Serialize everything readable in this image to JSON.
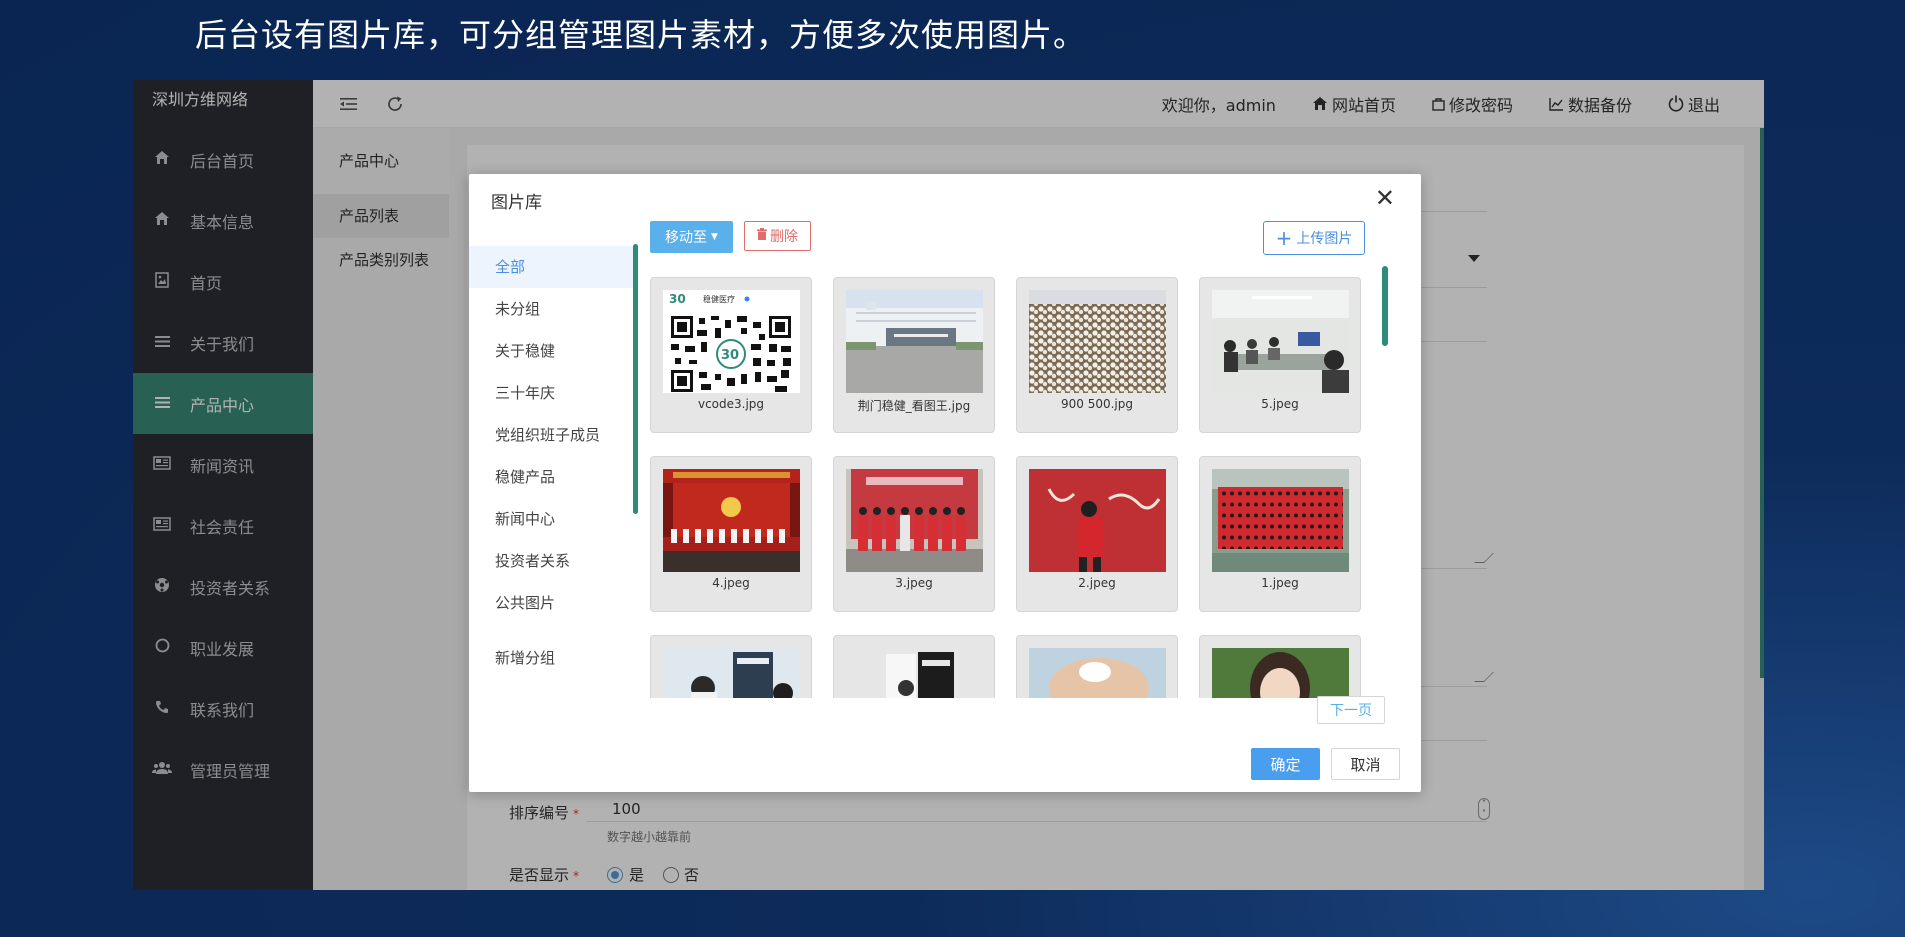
{
  "headline": "后台设有图片库，可分组管理图片素材，方便多次使用图片。",
  "sidebar": {
    "brand": "深圳方维网络",
    "items": [
      {
        "label": "后台首页",
        "icon": "home-icon"
      },
      {
        "label": "基本信息",
        "icon": "home-icon"
      },
      {
        "label": "首页",
        "icon": "image-file-icon"
      },
      {
        "label": "关于我们",
        "icon": "list-icon"
      },
      {
        "label": "产品中心",
        "icon": "list-icon",
        "active": true
      },
      {
        "label": "新闻资讯",
        "icon": "newspaper-icon"
      },
      {
        "label": "社会责任",
        "icon": "newspaper-icon"
      },
      {
        "label": "投资者关系",
        "icon": "ball-icon"
      },
      {
        "label": "职业发展",
        "icon": "circle-icon"
      },
      {
        "label": "联系我们",
        "icon": "phone-icon"
      },
      {
        "label": "管理员管理",
        "icon": "users-icon"
      }
    ]
  },
  "subnav": {
    "title": "产品中心",
    "items": [
      "产品列表",
      "产品类别列表"
    ]
  },
  "topbar": {
    "welcome": "欢迎你，admin",
    "site_home": "网站首页",
    "change_password": "修改密码",
    "data_backup": "数据备份",
    "logout": "退出"
  },
  "form": {
    "sort_label": "排序编号",
    "sort_value": "100",
    "sort_hint": "数字越小越靠前",
    "show_label": "是否显示",
    "show_yes": "是",
    "show_no": "否",
    "show_selected": "是"
  },
  "modal": {
    "title": "图片库",
    "groups": [
      "全部",
      "未分组",
      "关于稳健",
      "三十年庆",
      "党组织班子成员",
      "稳健产品",
      "新闻中心",
      "投资者关系",
      "公共图片"
    ],
    "active_group": "全部",
    "add_group": "新增分组",
    "move_to": "移动至",
    "delete": "删除",
    "upload": "上传图片",
    "images": [
      {
        "caption": "vcode3.jpg"
      },
      {
        "caption": "荆门稳健_看图王.jpg"
      },
      {
        "caption": "900 500.jpg"
      },
      {
        "caption": "5.jpeg"
      },
      {
        "caption": "4.jpeg"
      },
      {
        "caption": "3.jpeg"
      },
      {
        "caption": "2.jpeg"
      },
      {
        "caption": "1.jpeg"
      },
      {
        "caption": ""
      },
      {
        "caption": ""
      },
      {
        "caption": ""
      },
      {
        "caption": ""
      }
    ],
    "qr_brand": "稳健医疗",
    "next_page": "下一页",
    "ok": "确定",
    "cancel": "取消"
  },
  "colors": {
    "accent_green": "#3a8a78",
    "primary_blue": "#4a9ef0",
    "danger_red": "#e06c6c",
    "sidebar_bg": "#2b2e35"
  }
}
